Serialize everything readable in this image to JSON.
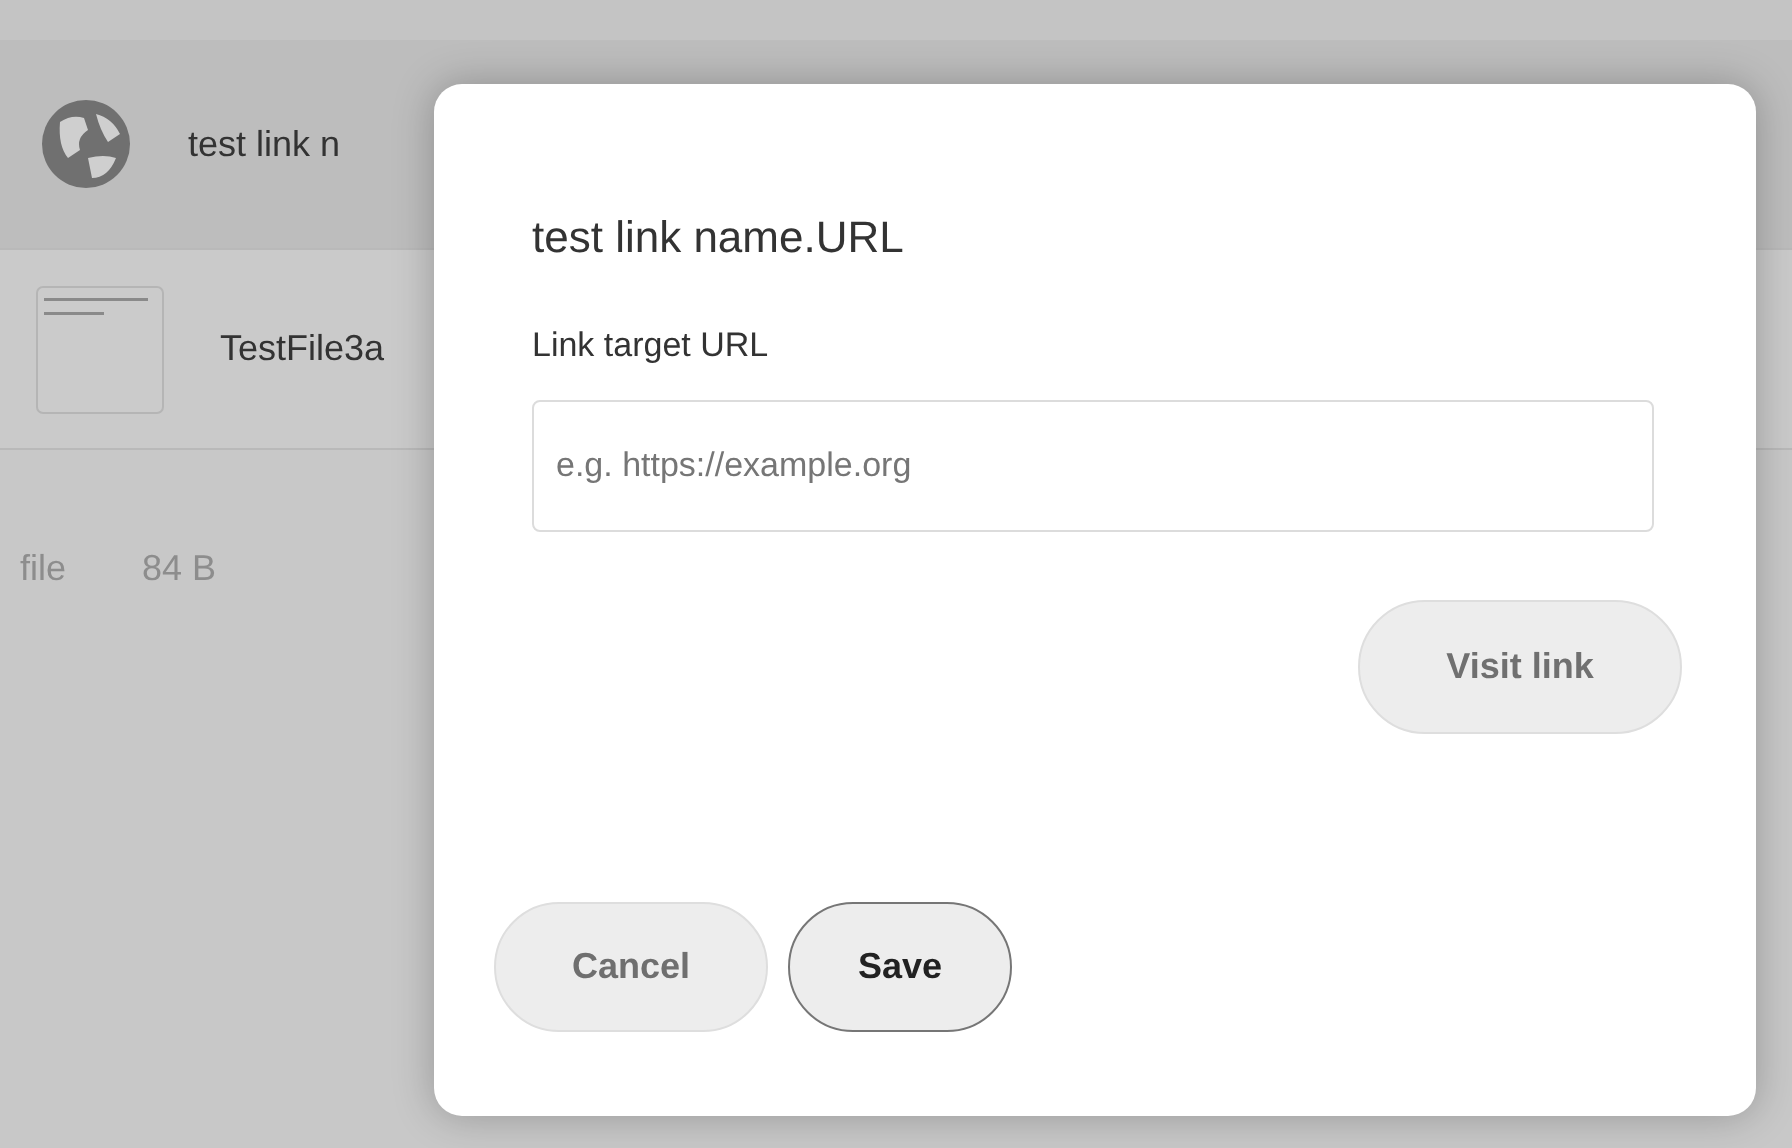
{
  "file_list": {
    "rows": [
      {
        "kind": "link",
        "name": "test link n",
        "selected": true
      },
      {
        "kind": "file",
        "name": "TestFile3a",
        "selected": false
      }
    ],
    "summary": {
      "count": "file",
      "size": "84 B"
    }
  },
  "dialog": {
    "title": "test link name.URL",
    "field": {
      "label": "Link target URL",
      "placeholder": "e.g. https://example.org"
    },
    "visit_button": "Visit link",
    "buttons": [
      {
        "label": "Cancel",
        "kind": "secondary"
      },
      {
        "label": "Save",
        "kind": "primary"
      }
    ]
  }
}
